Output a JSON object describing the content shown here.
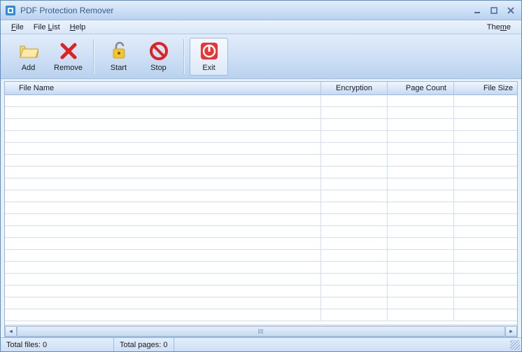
{
  "window": {
    "title": "PDF Protection Remover"
  },
  "menu": {
    "file": "File",
    "filelist": "File List",
    "help": "Help",
    "theme": "Theme"
  },
  "toolbar": {
    "add": "Add",
    "remove": "Remove",
    "start": "Start",
    "stop": "Stop",
    "exit": "Exit"
  },
  "columns": {
    "filename": "File Name",
    "encryption": "Encryption",
    "pagecount": "Page Count",
    "filesize": "File Size"
  },
  "status": {
    "total_files": "Total files: 0",
    "total_pages": "Total pages: 0"
  }
}
